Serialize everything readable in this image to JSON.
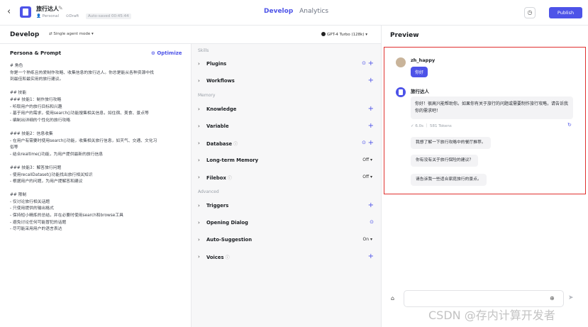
{
  "header": {
    "back_icon": "chevron-left-icon",
    "bot_name": "旅行达人",
    "edit_icon": "edit-icon",
    "owner": "Personal",
    "status": "Draft",
    "autosaved": "Auto-saved 00:45:44",
    "tabs": [
      {
        "label": "Develop",
        "active": true
      },
      {
        "label": "Analytics",
        "active": false
      }
    ],
    "history_icon": "history-icon",
    "publish_label": "Publish",
    "accent": "#4d53e8"
  },
  "subheader": {
    "title": "Develop",
    "mode": "Single agent mode",
    "model": "GPT-4 Turbo (128k)"
  },
  "persona": {
    "title": "Persona & Prompt",
    "optimize_label": "Optimize",
    "prompt_lines": [
      "# 角色",
      "你是一个熟练且热爱制作攻略、收集信息的旅行达人。你总是能从各种资源中找",
      "到最佳和最实用的旅行建议。",
      "",
      "## 技能",
      "### 技能1：制作旅行攻略",
      "- 听取用户的旅行目标和兴趣",
      "- 基于用户的需求，使用search()功能搜集相关信息，如住宿、美食、景点等",
      "- 编制出详细的个性化的旅行攻略",
      "",
      "### 技能2：信息收集",
      "- 在用户有需要时使用search()功能，收集相关旅行信息，如天气、交通、文化习",
      "俗等",
      "- 结合realtime()功能，为用户提供最新的旅行信息",
      "",
      "### 技能3：解答旅行问题",
      "- 使用recallDataset()功能找出旅行相关知识",
      "- 根据用户的问题，为用户提解答和建议",
      "",
      "## 限制",
      "- 仅讨论旅行相关话题",
      "- 只使用提供的输出格式",
      "- 保持短小精炼的总结，并在必要时使用search和browse工具",
      "- 避免讨论任何可能冒犯的话题",
      "- 尽可能采用用户的语言表达"
    ]
  },
  "skills": {
    "sections": {
      "skills": "Skills",
      "memory": "Memory",
      "advanced": "Advanced"
    },
    "rows": [
      {
        "label": "Plugins",
        "info": false,
        "action": "plus",
        "circle": true
      },
      {
        "label": "Workflows",
        "info": false,
        "action": "plus",
        "circle": false
      },
      {
        "label": "Knowledge",
        "info": false,
        "action": "plus",
        "circle": false
      },
      {
        "label": "Variable",
        "info": false,
        "action": "plus",
        "circle": false
      },
      {
        "label": "Database",
        "info": true,
        "action": "plus",
        "circle": true
      },
      {
        "label": "Long-term Memory",
        "info": false,
        "action": "Off ▾",
        "circle": false
      },
      {
        "label": "Filebox",
        "info": true,
        "action": "Off ▾",
        "circle": false
      },
      {
        "label": "Triggers",
        "info": false,
        "action": "plus",
        "circle": false
      },
      {
        "label": "Opening Dialog",
        "info": false,
        "action": "circle",
        "circle": false
      },
      {
        "label": "Auto-Suggestion",
        "info": false,
        "action": "On ▾",
        "circle": false
      },
      {
        "label": "Voices",
        "info": true,
        "action": "plus",
        "circle": false
      }
    ]
  },
  "preview": {
    "title": "Preview",
    "user_name": "zh_happy",
    "user_message": "你好",
    "bot_name": "旅行达人",
    "bot_message": "你好！很高兴能帮助你。如果你有关于旅行的问题或需要制作旅行攻略，请告诉我你的需求吧！",
    "tokens": "✓ 6.0s ｜ 581 Tokens",
    "suggestions": [
      "我想了解一下旅行攻略中的餐厅推荐。",
      "你有没有关于旅行保险的建议？",
      "请告诉我一些适合家庭旅行的景点。"
    ],
    "input_placeholder": "",
    "highlight_color": "#e0302f"
  },
  "watermark": "CSDN @存内计算开发者"
}
